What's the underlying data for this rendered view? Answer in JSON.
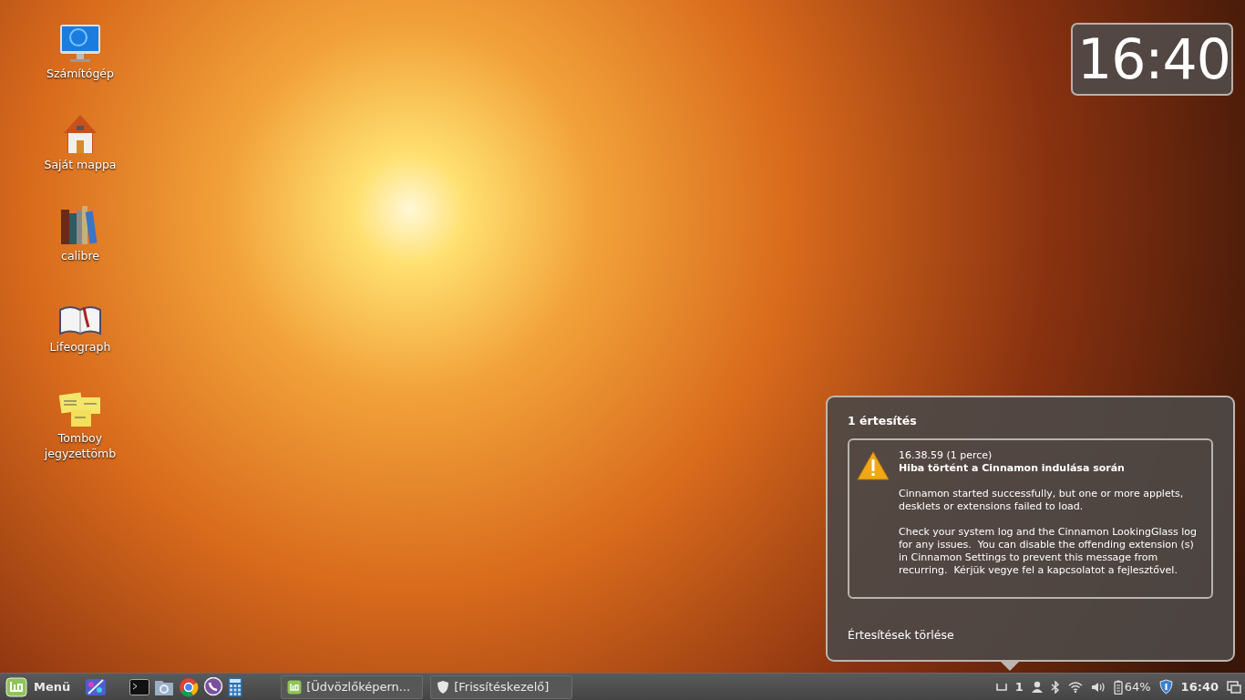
{
  "desktop": {
    "icons": [
      {
        "kind": "computer",
        "label": "Számítógép"
      },
      {
        "kind": "home",
        "label": "Saját mappa"
      },
      {
        "kind": "books",
        "label": "calibre"
      },
      {
        "kind": "book",
        "label": "Lifeograph"
      },
      {
        "kind": "notes",
        "label": "Tomboy jegyzettömb"
      }
    ]
  },
  "clock_desklet": {
    "time": "16:40"
  },
  "notification_popup": {
    "heading": "1 értesítés",
    "notifications": [
      {
        "time": "16.38.59 (1 perce)",
        "title": "Hiba történt a Cinnamon indulása során",
        "paragraphs": [
          "Cinnamon started successfully, but one or more applets, desklets or extensions failed to load.",
          "Check your system log and the Cinnamon LookingGlass log for any issues.  You can disable the offending extension (s) in Cinnamon Settings to prevent this message from recurring.  Kérjük vegye fel a kapcsolatot a fejlesztővel."
        ]
      }
    ],
    "clear_button": "Értesítések törlése"
  },
  "panel": {
    "menu_label": "Menü",
    "launchers": [
      {
        "kind": "paint"
      },
      {
        "kind": "terminal"
      },
      {
        "kind": "folder"
      },
      {
        "kind": "browser"
      },
      {
        "kind": "phone"
      },
      {
        "kind": "calculator"
      }
    ],
    "windows": [
      {
        "kind": "mint",
        "label": "[Üdvözlőképern..."
      },
      {
        "kind": "shield",
        "label": "[Frissítéskezelő]"
      }
    ],
    "tray": {
      "workspace": "1",
      "battery": "64%",
      "time": "16:40"
    }
  }
}
